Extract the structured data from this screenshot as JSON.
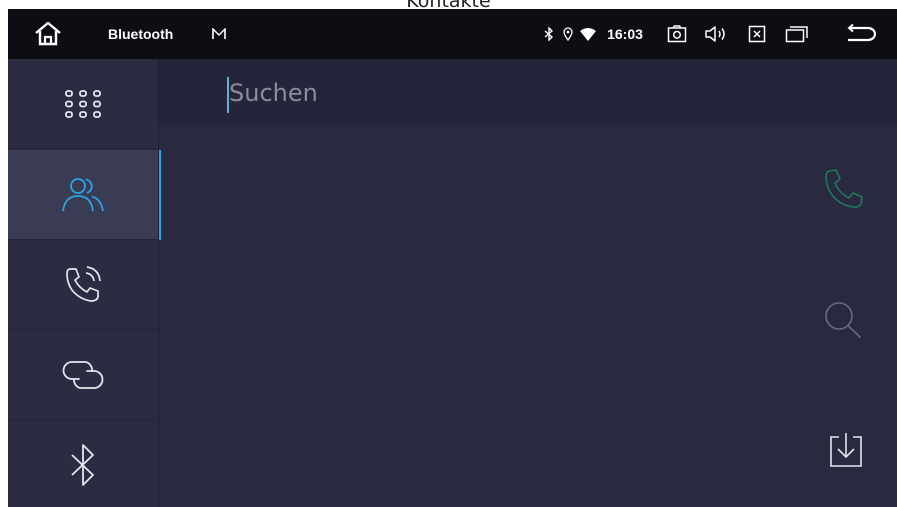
{
  "caption": "Kontakte",
  "statusbar": {
    "title": "Bluetooth",
    "time": "16:03",
    "icons": [
      "home-icon",
      "gmail-icon",
      "bluetooth-icon",
      "location-icon",
      "wifi-icon",
      "screenshot-icon",
      "volume-icon",
      "close-app-icon",
      "recent-apps-icon",
      "back-icon"
    ]
  },
  "sidebar": {
    "items": [
      {
        "name": "apps-grid",
        "icon": "grid-icon",
        "active": false
      },
      {
        "name": "contacts",
        "icon": "contacts-icon",
        "active": true
      },
      {
        "name": "call-log",
        "icon": "phone-ring-icon",
        "active": false
      },
      {
        "name": "pairing",
        "icon": "link-icon",
        "active": false
      },
      {
        "name": "bluetooth-settings",
        "icon": "bluetooth-icon",
        "active": false
      }
    ]
  },
  "search": {
    "placeholder": "Suchen",
    "value": ""
  },
  "actions": [
    "phone-icon",
    "search-icon",
    "download-icon"
  ],
  "colors": {
    "accent": "#2aa6e0",
    "background": "#292a40",
    "statusbar": "#0d0d13",
    "call_green": "#1f7a5a"
  }
}
